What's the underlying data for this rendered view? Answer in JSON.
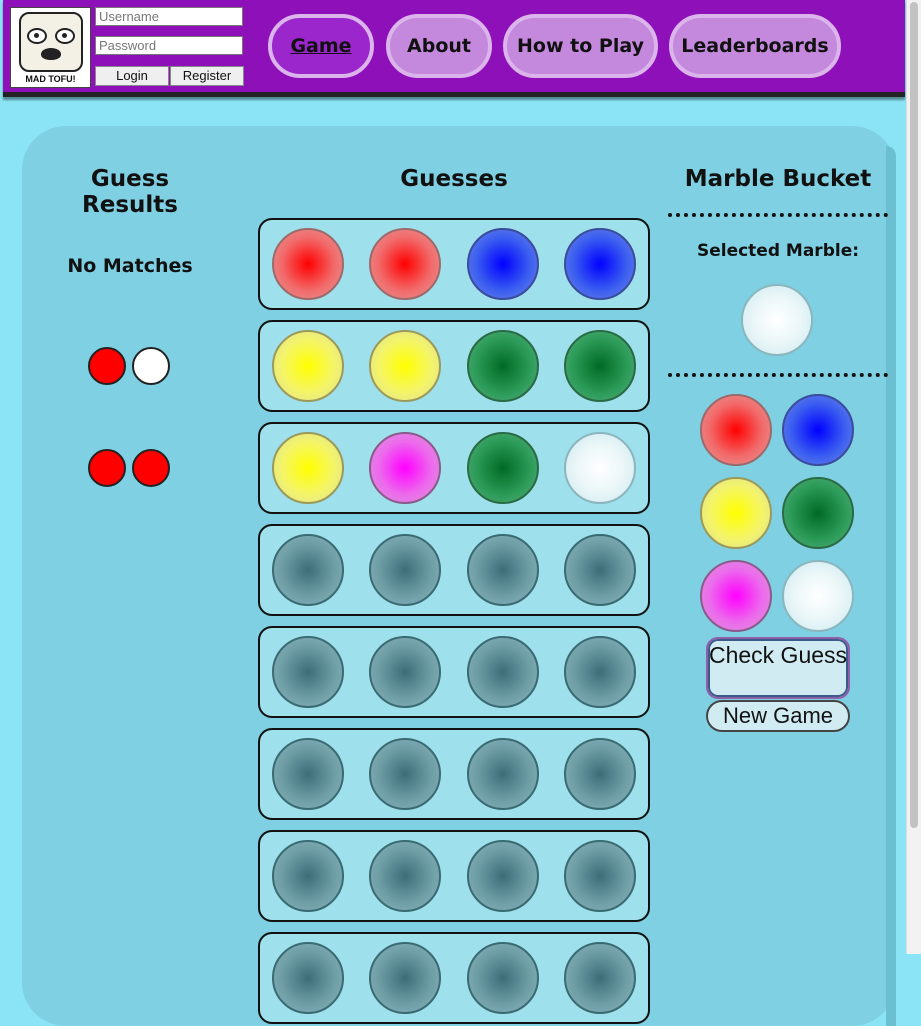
{
  "header": {
    "logo_text": "MAD TOFU!",
    "username_placeholder": "Username",
    "password_placeholder": "Password",
    "login_label": "Login",
    "register_label": "Register",
    "nav": [
      {
        "label": "Game",
        "active": true
      },
      {
        "label": "About",
        "active": false
      },
      {
        "label": "How to Play",
        "active": false
      },
      {
        "label": "Leaderboards",
        "active": false
      }
    ]
  },
  "game": {
    "results_title": "Guess Results",
    "guesses_title": "Guesses",
    "bucket_title": "Marble Bucket",
    "selected_label": "Selected Marble:",
    "selected_marble": "white",
    "results": [
      {
        "text": "No Matches",
        "pegs": []
      },
      {
        "text": "",
        "pegs": [
          "red",
          "white"
        ]
      },
      {
        "text": "",
        "pegs": [
          "red",
          "red"
        ]
      }
    ],
    "guesses": [
      [
        "red",
        "red",
        "blue",
        "blue"
      ],
      [
        "yellow",
        "yellow",
        "green",
        "green"
      ],
      [
        "yellow",
        "magenta",
        "green",
        "white"
      ],
      [
        "empty",
        "empty",
        "empty",
        "empty"
      ],
      [
        "empty",
        "empty",
        "empty",
        "empty"
      ],
      [
        "empty",
        "empty",
        "empty",
        "empty"
      ],
      [
        "empty",
        "empty",
        "empty",
        "empty"
      ],
      [
        "empty",
        "empty",
        "empty",
        "empty"
      ]
    ],
    "bucket": [
      "red",
      "blue",
      "yellow",
      "green",
      "magenta",
      "white"
    ],
    "check_label": "Check Guess",
    "new_game_label": "New Game"
  },
  "colors": {
    "header_bg": "#8e10b8",
    "page_bg": "#8ae4f5",
    "board_bg": "#7fd0e2",
    "row_bg": "#9ee0ec"
  }
}
